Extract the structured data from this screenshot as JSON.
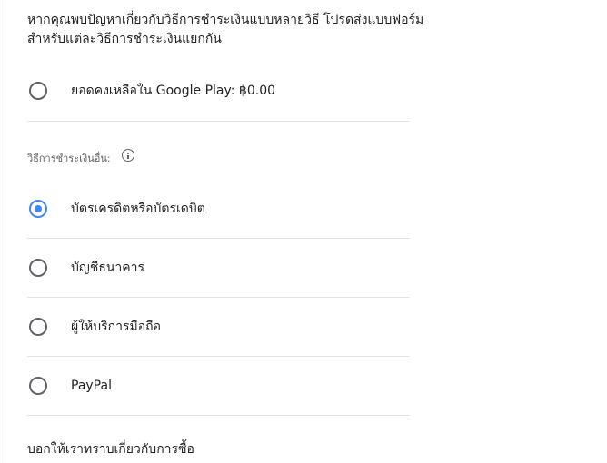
{
  "intro": {
    "text": "หากคุณพบปัญหาเกี่ยวกับวิธีการชำระเงินแบบหลายวิธี โปรดส่งแบบฟอร์มสำหรับแต่ละวิธีการชำระเงินแยกกัน"
  },
  "google_play_option": {
    "label": "ยอดคงเหลือใน Google Play: ฿0.00",
    "selected": false
  },
  "other_methods": {
    "label": "วิธีการชำระเงินอื่น:",
    "info_icon": "info-icon",
    "options": [
      {
        "label": "บัตรเครดิตหรือบัตรเดบิต",
        "selected": true
      },
      {
        "label": "บัญชีธนาคาร",
        "selected": false
      },
      {
        "label": "ผู้ให้บริการมือถือ",
        "selected": false
      },
      {
        "label": "PayPal",
        "selected": false
      }
    ]
  },
  "footer": {
    "text": "บอกให้เราทราบเกี่ยวกับการซื้อ"
  },
  "colors": {
    "radio_selected": "#4285f4",
    "radio_unselected": "#5f6368",
    "divider": "#e4e4e4",
    "text": "#202124",
    "secondary_text": "#5f6368"
  }
}
